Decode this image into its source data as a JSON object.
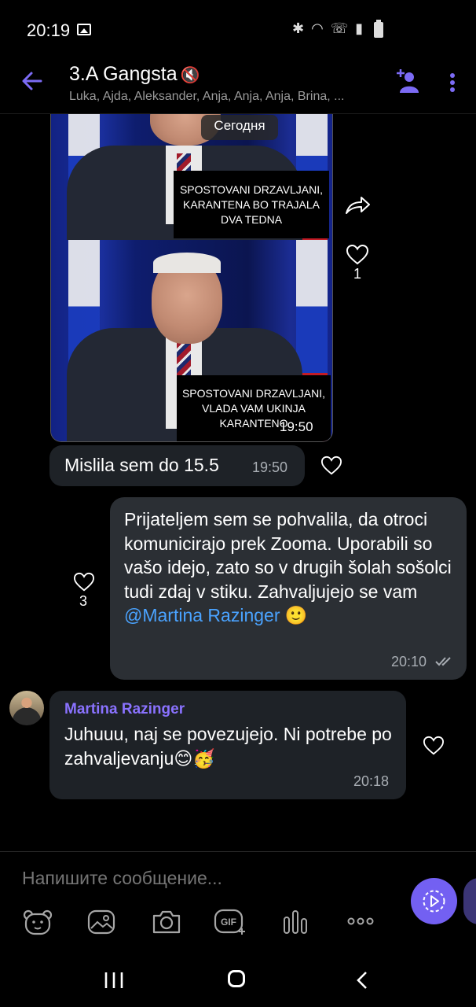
{
  "status_bar": {
    "time": "20:19"
  },
  "header": {
    "title": "3.A Gangsta",
    "mute_icon": "🔇",
    "members": "Luka, Ajda, Aleksander, Anja, Anja, Anja, Brina, ..."
  },
  "date_divider": "Сегодня",
  "photo_message": {
    "caption_top": "SPOSTOVANI DRZAVLJANI, KARANTENA BO TRAJALA DVA TEDNA",
    "caption_bottom": "SPOSTOVANI DRZAVLJANI, VLADA VAM UKINJA KARANTENO",
    "time": "19:50",
    "likes": "1"
  },
  "messages": [
    {
      "text": "Mislila sem do 15.5",
      "time": "19:50"
    },
    {
      "text": "Prijateljem sem se pohvalila, da otroci komunicirajo prek Zooma. Uporabili so vašo idejo, zato so v drugih šolah sošolci tudi zdaj v stiku. Zahvaljujejo se vam ",
      "mention": "@Martina Razinger",
      "emoji": "🙂",
      "time": "20:10",
      "likes": "3"
    },
    {
      "sender": "Martina Razinger",
      "text": "Juhuuu, naj se povezujejo. Ni potrebe po zahvaljevanju😊🥳",
      "time": "20:18"
    }
  ],
  "composer": {
    "placeholder": "Напишите сообщение..."
  },
  "colors": {
    "accent": "#7360f2",
    "mention": "#4aa3ff",
    "sender": "#8a72ff"
  }
}
